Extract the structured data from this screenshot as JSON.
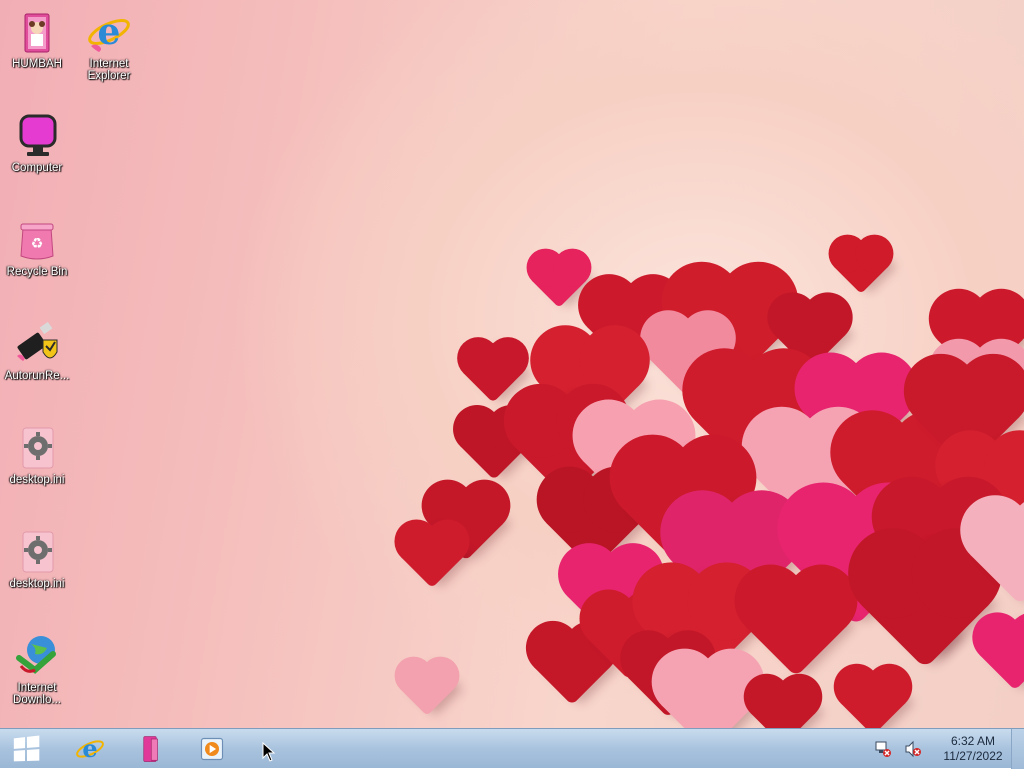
{
  "desktop": {
    "icons": [
      {
        "id": "humbah",
        "label": "HUMBAH",
        "icon": "pink-door-folder-icon"
      },
      {
        "id": "ie",
        "label": "Internet Explorer",
        "icon": "internet-explorer-icon"
      },
      {
        "id": "computer",
        "label": "Computer",
        "icon": "pink-monitor-icon"
      },
      {
        "id": "recycle",
        "label": "Recycle Bin",
        "icon": "pink-recycle-bin-icon"
      },
      {
        "id": "autorun",
        "label": "AutorunRe...",
        "icon": "usb-shield-icon"
      },
      {
        "id": "ini1",
        "label": "desktop.ini",
        "icon": "settings-file-icon"
      },
      {
        "id": "ini2",
        "label": "desktop.ini",
        "icon": "settings-file-icon"
      },
      {
        "id": "idm",
        "label": "Internet Downlo...",
        "icon": "download-globe-icon"
      }
    ]
  },
  "taskbar": {
    "start_label": "Start",
    "pinned": [
      {
        "name": "internet-explorer",
        "icon": "internet-explorer-icon"
      },
      {
        "name": "file-explorer",
        "icon": "pink-folder-icon"
      },
      {
        "name": "media-player",
        "icon": "media-player-icon"
      }
    ],
    "tray": {
      "network_icon": "network-error-icon",
      "volume_icon": "volume-muted-icon",
      "time": "6:32 AM",
      "date": "11/27/2022"
    }
  },
  "colors": {
    "taskbar_top": "#c9dcee",
    "taskbar_bottom": "#9ab7d5",
    "heart_red": "#d01d2c",
    "heart_pink": "#f47a96",
    "heart_magenta": "#e8246f",
    "wallpaper_pink": "#f2aeb5"
  }
}
